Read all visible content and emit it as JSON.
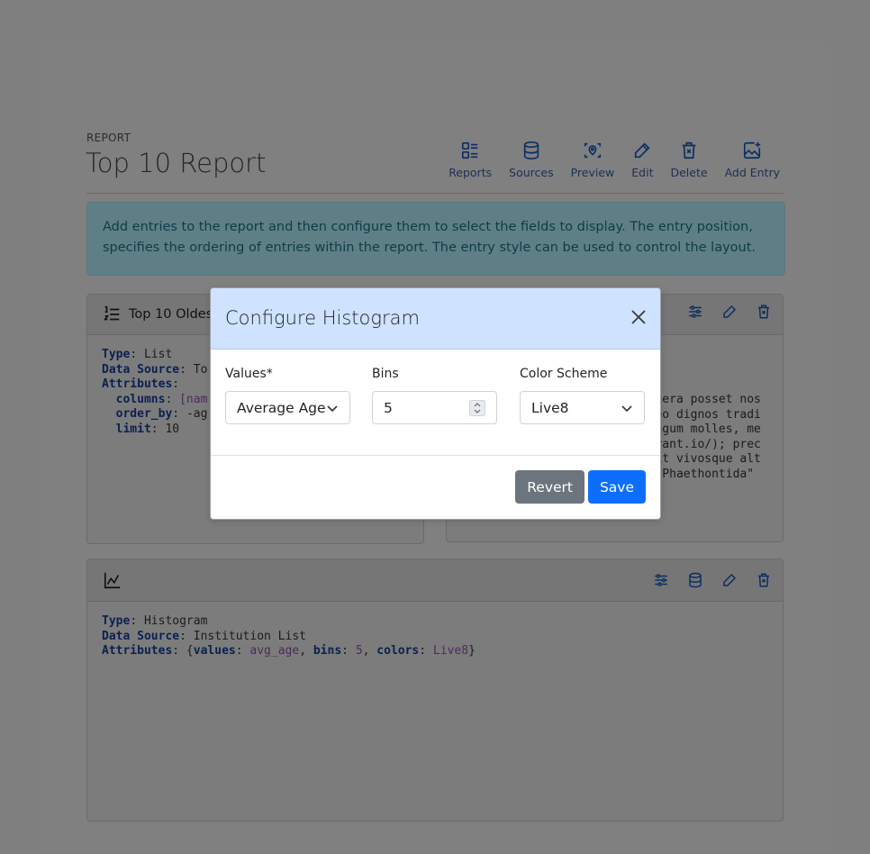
{
  "header": {
    "eyebrow": "REPORT",
    "title": "Top 10 Report",
    "toolbar": [
      {
        "label": "Reports",
        "icon": "list-icon"
      },
      {
        "label": "Sources",
        "icon": "database-icon"
      },
      {
        "label": "Preview",
        "icon": "preview-icon"
      },
      {
        "label": "Edit",
        "icon": "pencil-icon"
      },
      {
        "label": "Delete",
        "icon": "trash-icon"
      },
      {
        "label": "Add Entry",
        "icon": "add-image-icon"
      }
    ]
  },
  "alert": {
    "text": "Add entries to the report and then configure them to select the fields to display. The entry position, specifies the ordering of entries within the report. The entry style can be used to control the layout."
  },
  "card1": {
    "title": "Top 10 Oldest",
    "lines": [
      {
        "key": "Type",
        "value": "List"
      },
      {
        "key": "Data Source",
        "value": "To"
      },
      {
        "key": "Attributes",
        "value": ""
      },
      {
        "key": "columns",
        "value": "[nam"
      },
      {
        "key": "order_by",
        "value": "-ag"
      },
      {
        "key": "limit",
        "value": "10"
      }
    ]
  },
  "card2": {
    "lines": [
      "nt aera posset nos",
      "mineo dignos tradi",
      " longum molles, me",
      "mrorant.io/); prec",
      "dicit vivosque alt",
      "gia Phaethontida\""
    ]
  },
  "card3": {
    "type_key": "Type",
    "type_value": "Histogram",
    "source_key": "Data Source",
    "source_value": "Institution List",
    "attr_key": "Attributes",
    "values_key": "values",
    "values_value": "avg_age",
    "bins_key": "bins",
    "bins_value": "5",
    "colors_key": "colors",
    "colors_value": "Live8"
  },
  "modal": {
    "title": "Configure Histogram",
    "values_label": "Values*",
    "values_selected": "Average Age",
    "bins_label": "Bins",
    "bins_value": "5",
    "color_label": "Color Scheme",
    "color_selected": "Live8",
    "revert_label": "Revert",
    "save_label": "Save"
  },
  "colors": {
    "primary": "#0d6efd",
    "secondary": "#6c757d",
    "modal_header": "#cfe2ff"
  }
}
